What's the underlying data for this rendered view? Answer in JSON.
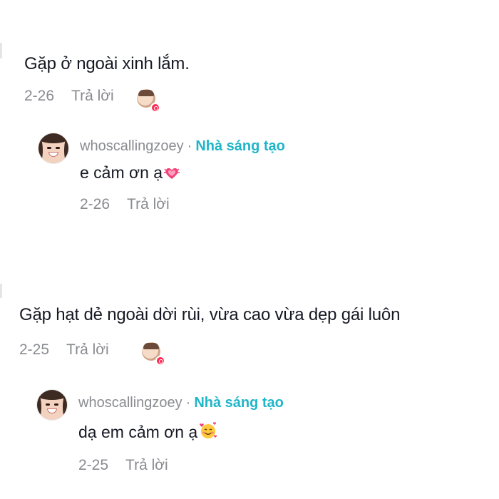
{
  "comments": [
    {
      "text": "Gặp ở ngoài xinh lắm.",
      "date": "2-26",
      "reply_label": "Trả lời",
      "reply": {
        "username": "whoscallingzoey",
        "separator": "·",
        "badge": "Nhà sáng tạo",
        "text": "e cảm ơn ạ",
        "emoji": "growing-heart-icon",
        "date": "2-26",
        "reply_label": "Trả lời"
      }
    },
    {
      "text": "Gặp hạt dẻ ngoài dời rùi, vừa cao vừa dẹp gái luôn",
      "date": "2-25",
      "reply_label": "Trả lời",
      "reply": {
        "username": "whoscallingzoey",
        "separator": "·",
        "badge": "Nhà sáng tạo",
        "text": "dạ em cảm ơn ạ",
        "emoji": "smiling-face-with-hearts-icon",
        "date": "2-25",
        "reply_label": "Trả lời"
      }
    }
  ],
  "colors": {
    "text": "#161823",
    "meta": "#8a8b91",
    "creator_badge": "#20b5c8",
    "like_heart": "#fe2c55"
  }
}
